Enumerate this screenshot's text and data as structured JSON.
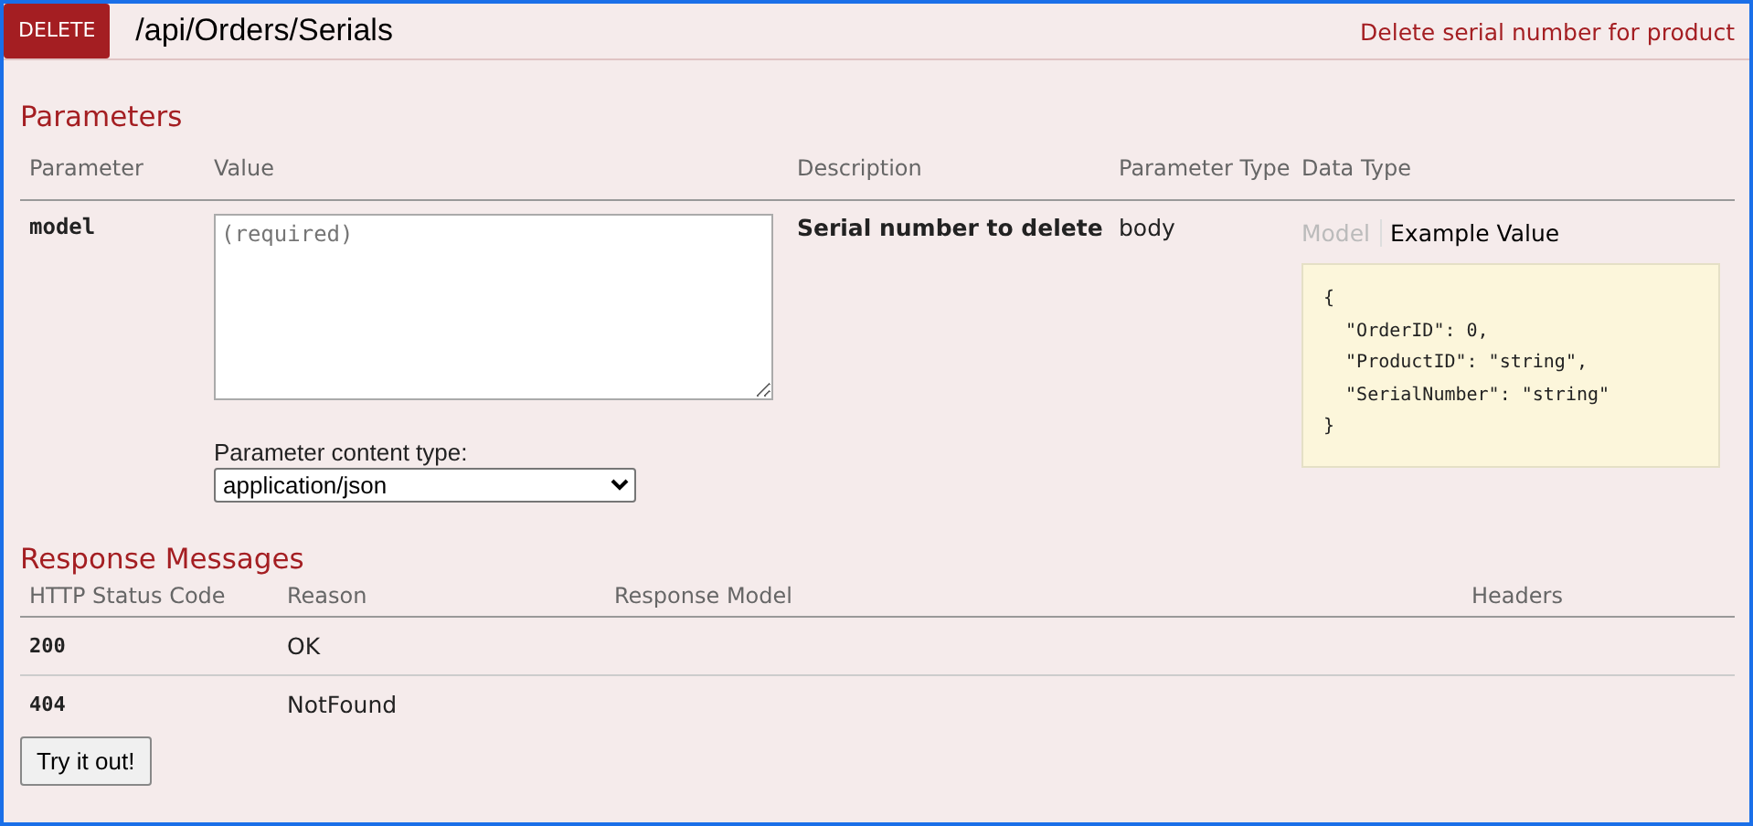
{
  "operation": {
    "method": "DELETE",
    "path": "/api/Orders/Serials",
    "summary": "Delete serial number for product"
  },
  "parameters": {
    "title": "Parameters",
    "columns": [
      "Parameter",
      "Value",
      "Description",
      "Parameter Type",
      "Data Type"
    ],
    "rows": [
      {
        "name": "model",
        "placeholder": "(required)",
        "description": "Serial number to delete",
        "type": "body",
        "signature_tabs": [
          {
            "label": "Model",
            "selected": false
          },
          {
            "label": "Example Value",
            "selected": true
          }
        ],
        "example": [
          "{",
          "  \"OrderID\": 0,",
          "  \"ProductID\": \"string\",",
          "  \"SerialNumber\": \"string\"",
          "}"
        ],
        "content_type_label": "Parameter content type:",
        "content_type": "application/json"
      }
    ]
  },
  "responses": {
    "title": "Response Messages",
    "columns": [
      "HTTP Status Code",
      "Reason",
      "Response Model",
      "Headers"
    ],
    "rows": [
      {
        "code": "200",
        "reason": "OK"
      },
      {
        "code": "404",
        "reason": "NotFound"
      }
    ]
  },
  "submit_button": "Try it out!"
}
